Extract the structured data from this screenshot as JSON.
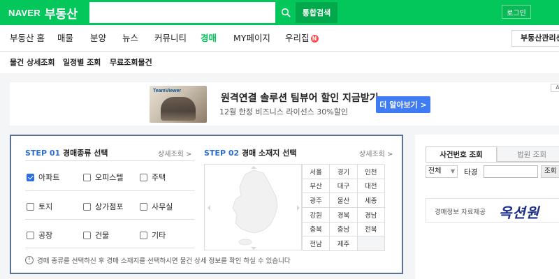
{
  "header": {
    "brand": "NAVER",
    "service": "부동산",
    "search_placeholder": "",
    "total_search_label": "통합검색",
    "login_label": "로그인"
  },
  "main_nav": {
    "items": [
      "부동산 홈",
      "매물",
      "분양",
      "뉴스",
      "커뮤니티",
      "경매",
      "MY페이지",
      "우리집"
    ],
    "active": "경매",
    "new_badge": "N",
    "agent_button": "부동산관리센"
  },
  "sub_nav": {
    "items": [
      "물건 상세조회",
      "일정별 조회",
      "무료조회물건"
    ]
  },
  "ad": {
    "brand_label": "TeamViewer",
    "title": "원격연결 솔루션 팀뷰어 할인 지금받기",
    "subtitle": "12월 한정 비즈니스 라이선스 30%할인",
    "cta": "더 알아보기 >",
    "mark": "A"
  },
  "step1": {
    "prefix": "STEP ",
    "num": "01",
    "title": " 경매종류 선택",
    "detail_link": "상세조회 >",
    "options": [
      {
        "label": "아파트",
        "checked": true
      },
      {
        "label": "오피스텔",
        "checked": false
      },
      {
        "label": "주택",
        "checked": false
      },
      {
        "label": "토지",
        "checked": false
      },
      {
        "label": "상가점포",
        "checked": false
      },
      {
        "label": "사무실",
        "checked": false
      },
      {
        "label": "공장",
        "checked": false
      },
      {
        "label": "건물",
        "checked": false
      },
      {
        "label": "기타",
        "checked": false
      }
    ]
  },
  "step2": {
    "prefix": "STEP ",
    "num": "02",
    "title": " 경매 소재지 선택",
    "detail_link": "상세조회 >",
    "regions": [
      "서울",
      "경기",
      "인천",
      "부산",
      "대구",
      "대전",
      "광주",
      "울산",
      "세종",
      "강원",
      "경북",
      "경남",
      "충북",
      "충남",
      "전북",
      "전남",
      "제주",
      ""
    ]
  },
  "notice": "경매 종류를 선택하신 후 경매 소재지를 선택하시면 물건 상세 정보를 확인 하실 수 있습니다",
  "right_panel": {
    "tabs": [
      "사건번호 조회",
      "법원 조회"
    ],
    "select_value": "전체",
    "tg_label": "타경",
    "lookup_button": "조회",
    "provider_text": "경매정보 자료제공",
    "provider_logo": "옥션원"
  },
  "colors": {
    "brand_green": "#03c75a",
    "active_blue": "#2b6fd6",
    "cta_blue": "#3f7cf4",
    "panel_border": "#5b7096"
  }
}
